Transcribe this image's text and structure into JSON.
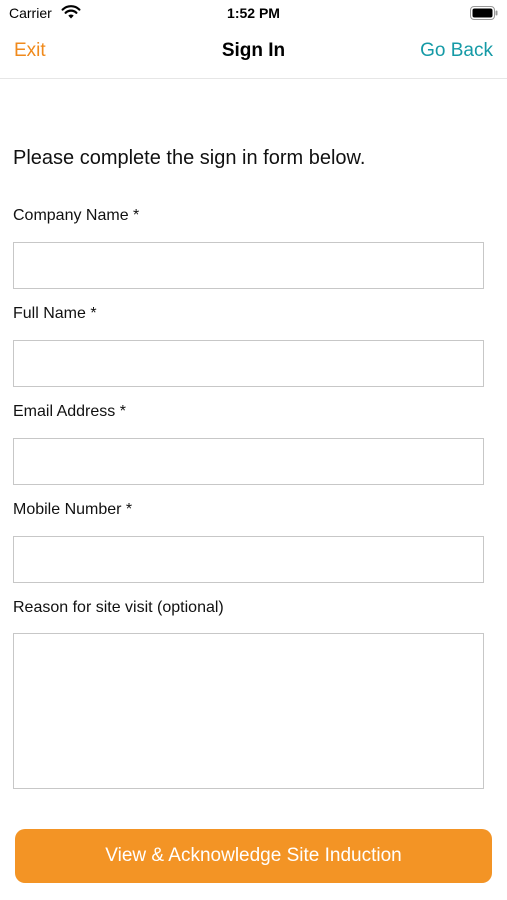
{
  "status_bar": {
    "carrier": "Carrier",
    "time": "1:52 PM",
    "wifi_icon": "wifi-icon",
    "battery_icon": "battery-icon"
  },
  "nav": {
    "exit_label": "Exit",
    "title": "Sign In",
    "back_label": "Go Back"
  },
  "form": {
    "intro": "Please complete the sign in form below.",
    "company_name": {
      "label": "Company Name *",
      "value": ""
    },
    "full_name": {
      "label": "Full Name *",
      "value": ""
    },
    "email": {
      "label": "Email Address *",
      "value": ""
    },
    "mobile": {
      "label": "Mobile Number *",
      "value": ""
    },
    "reason": {
      "label": "Reason for site visit (optional)",
      "value": ""
    }
  },
  "actions": {
    "primary_label": "View & Acknowledge Site Induction"
  },
  "colors": {
    "exit": "#f08a1c",
    "back": "#159aa6",
    "primary_button": "#f39425"
  }
}
